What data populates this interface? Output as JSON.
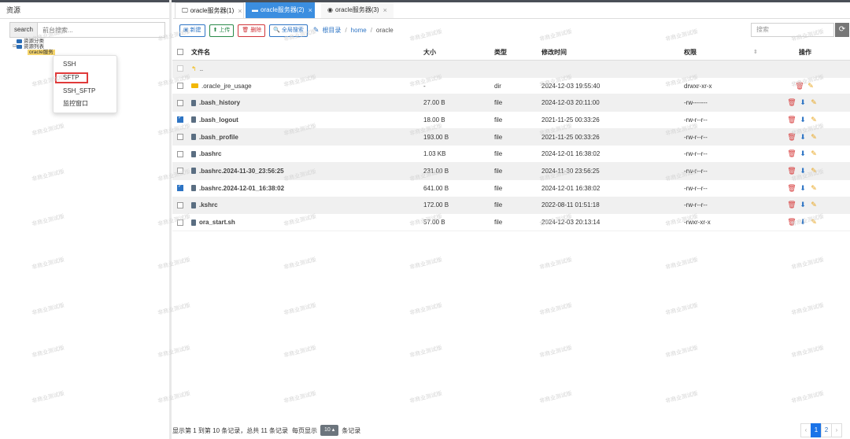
{
  "left": {
    "title": "资源",
    "search_label": "search",
    "search_placeholder": "前台搜索...",
    "tree": {
      "category": "资源分类",
      "list": "资源列表",
      "selected": "oracle服务"
    }
  },
  "context_menu": {
    "items": [
      "SSH",
      "SFTP",
      "SSH_SFTP",
      "监控窗口"
    ]
  },
  "tabs": [
    {
      "label": "oracle服务器(1)"
    },
    {
      "label": "oracle服务器(2)"
    },
    {
      "label": "oracle服务器(3)"
    }
  ],
  "toolbar": {
    "new": "新建",
    "upload": "上传",
    "delete": "删除",
    "global_search": "全局搜索",
    "breadcrumb_root": "根目录",
    "breadcrumb_home": "home",
    "breadcrumb_current": "oracle",
    "search_placeholder": "搜索"
  },
  "table": {
    "headers": {
      "name": "文件名",
      "size": "大小",
      "type": "类型",
      "time": "修改时间",
      "perm": "权限",
      "ops": "操作"
    },
    "parent": "..",
    "rows": [
      {
        "name": ".oracle_jre_usage",
        "size": "-",
        "type": "dir",
        "time": "2024-12-03 19:55:40",
        "perm": "drwxr-xr-x",
        "checked": false
      },
      {
        "name": ".bash_history",
        "size": "27.00 B",
        "type": "file",
        "time": "2024-12-03 20:11:00",
        "perm": "-rw-------",
        "checked": false
      },
      {
        "name": ".bash_logout",
        "size": "18.00 B",
        "type": "file",
        "time": "2021-11-25 00:33:26",
        "perm": "-rw-r--r--",
        "checked": true
      },
      {
        "name": ".bash_profile",
        "size": "193.00 B",
        "type": "file",
        "time": "2021-11-25 00:33:26",
        "perm": "-rw-r--r--",
        "checked": false
      },
      {
        "name": ".bashrc",
        "size": "1.03 KB",
        "type": "file",
        "time": "2024-12-01 16:38:02",
        "perm": "-rw-r--r--",
        "checked": false
      },
      {
        "name": ".bashrc.2024-11-30_23:56:25",
        "size": "231.00 B",
        "type": "file",
        "time": "2024-11-30 23:56:25",
        "perm": "-rw-r--r--",
        "checked": false
      },
      {
        "name": ".bashrc.2024-12-01_16:38:02",
        "size": "641.00 B",
        "type": "file",
        "time": "2024-12-01 16:38:02",
        "perm": "-rw-r--r--",
        "checked": true
      },
      {
        "name": ".kshrc",
        "size": "172.00 B",
        "type": "file",
        "time": "2022-08-11 01:51:18",
        "perm": "-rw-r--r--",
        "checked": false
      },
      {
        "name": "ora_start.sh",
        "size": "57.00 B",
        "type": "file",
        "time": "2024-12-03 20:13:14",
        "perm": "-rwxr-xr-x",
        "checked": false
      }
    ]
  },
  "footer": {
    "summary": "显示第 1 到第 10 条记录，总共 11 条记录",
    "per_page_prefix": "每页显示",
    "per_page_value": "10",
    "per_page_suffix": "条记录"
  },
  "pager": {
    "pages": [
      "1",
      "2"
    ],
    "current": "1"
  },
  "watermark": "非商业测试版"
}
